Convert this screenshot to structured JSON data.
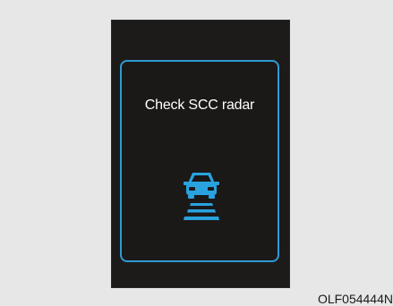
{
  "display": {
    "message": "Check SCC radar",
    "icon": "scc-radar-car-icon",
    "accent_color": "#2e9ad3",
    "icon_color": "#29a3e0"
  },
  "figure": {
    "code": "OLF054444N"
  }
}
